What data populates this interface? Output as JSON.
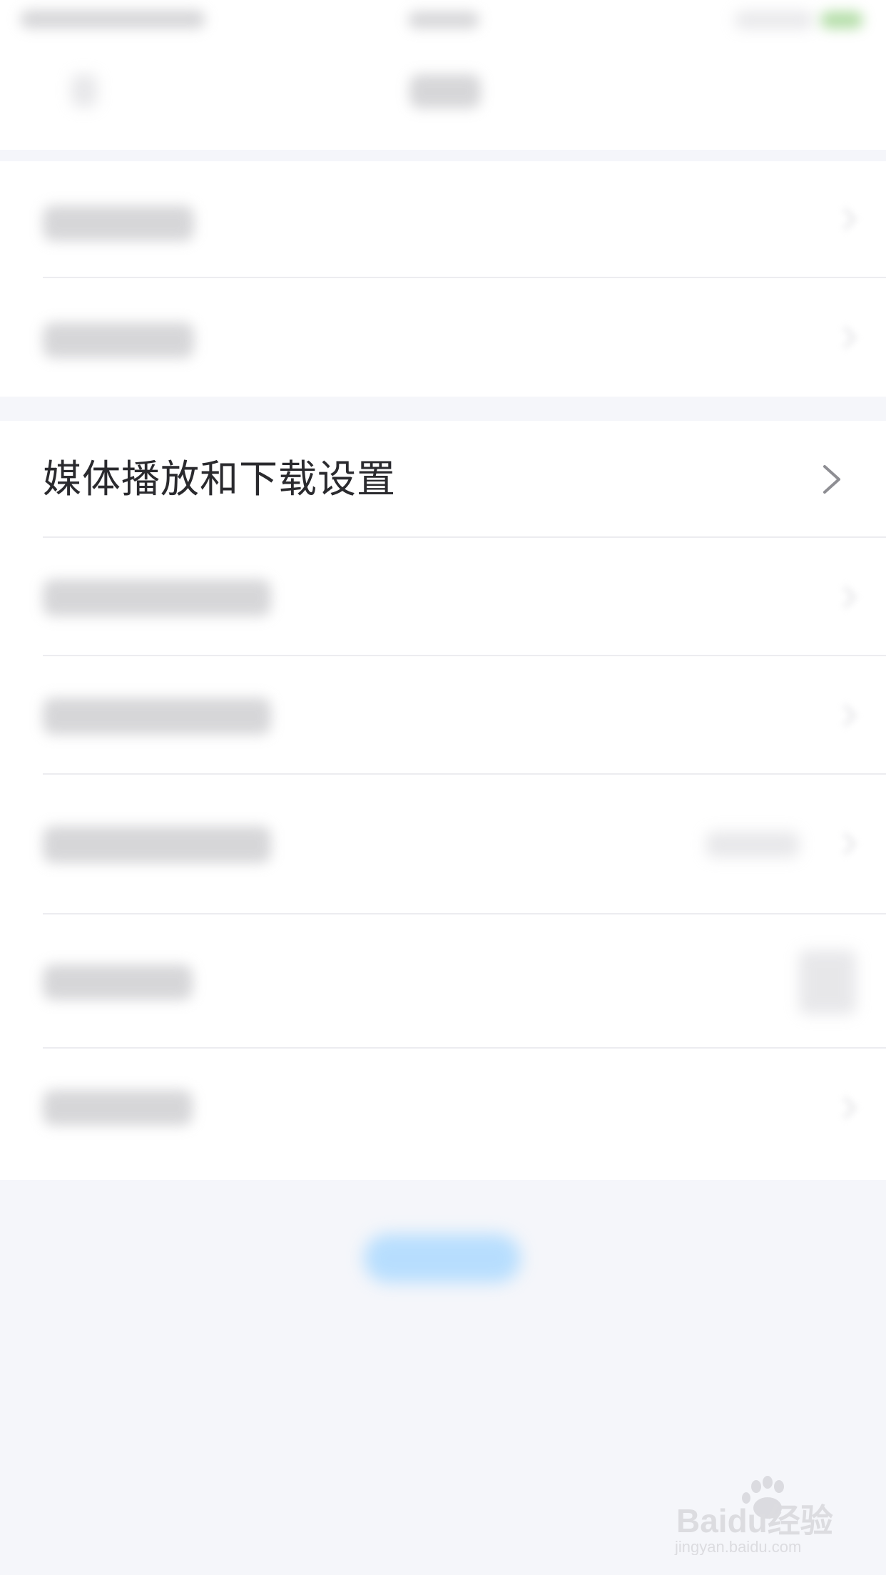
{
  "settings": {
    "media_row": {
      "label": "媒体播放和下载设置"
    }
  },
  "watermark": {
    "brand": "Baidu经验",
    "url": "jingyan.baidu.com"
  },
  "icons": {
    "row_chevron": "chevron-right-icon",
    "watermark_logo": "baidu-paw-icon"
  },
  "colors": {
    "page_bg": "#f5f6fa",
    "card_bg": "#ffffff",
    "label_text": "#2a2a2e",
    "chevron": "#8e8e93",
    "button_accent": "#a8d8ff"
  }
}
